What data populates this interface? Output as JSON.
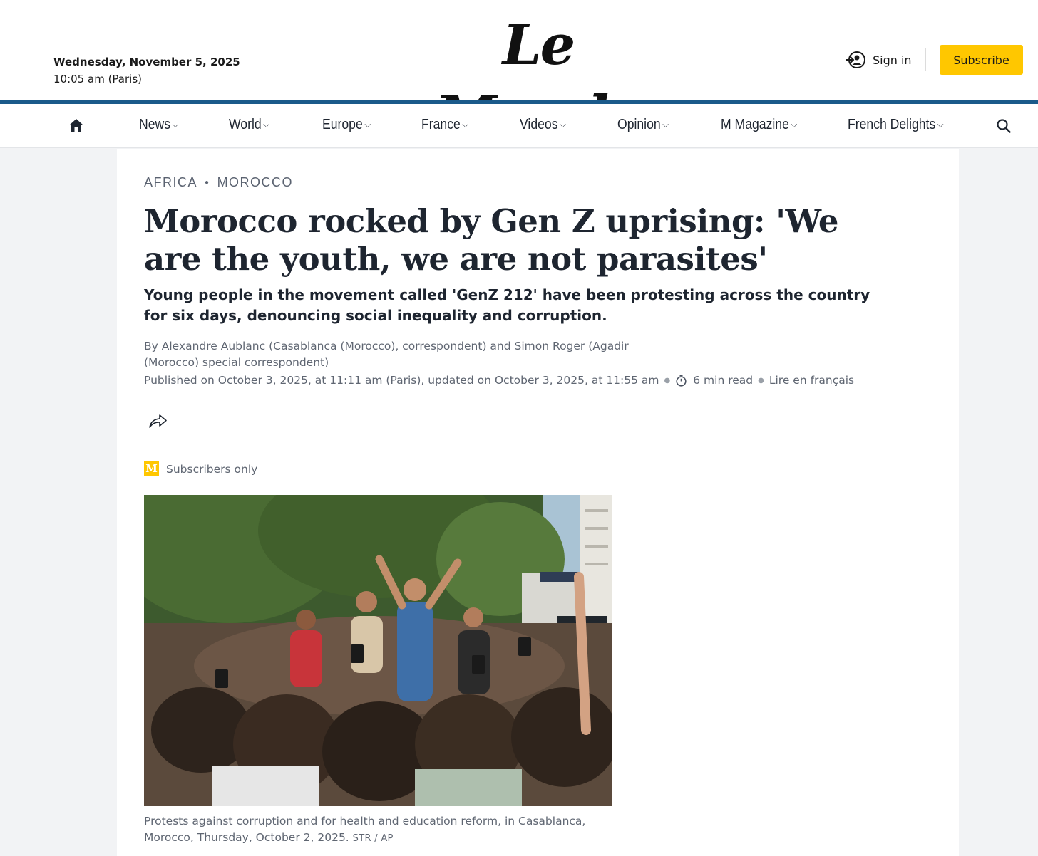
{
  "header": {
    "date": "Wednesday, November 5, 2025",
    "time": "10:05 am (Paris)",
    "logo_text": "Le Monde",
    "signin_label": "Sign in",
    "subscribe_label": "Subscribe",
    "accent_color": "#ffc700",
    "rule_color": "#1a5a8a"
  },
  "nav": {
    "items": [
      {
        "label": "News"
      },
      {
        "label": "World"
      },
      {
        "label": "Europe"
      },
      {
        "label": "France"
      },
      {
        "label": "Videos"
      },
      {
        "label": "Opinion"
      },
      {
        "label": "M Magazine"
      },
      {
        "label": "French Delights"
      }
    ],
    "home_icon": "home-icon",
    "search_icon": "search-icon"
  },
  "article": {
    "section": "AFRICA",
    "subsection": "MOROCCO",
    "headline": "Morocco rocked by Gen Z uprising: 'We are the youth, we are not parasites'",
    "standfirst": "Young people in the movement called 'GenZ 212' have been protesting across the country for six days, denouncing social inequality and corruption.",
    "byline": "By Alexandre Aublanc (Casablanca (Morocco), correspondent) and Simon Roger (Agadir (Morocco) special correspondent)",
    "published": "Published on October 3, 2025, at 11:11 am (Paris), updated on October 3, 2025, at 11:55 am",
    "read_time": "6 min read",
    "french_link": "Lire en français",
    "subscribers_badge": "M",
    "subscribers_label": "Subscribers only",
    "caption": "Protests against corruption and for health and education reform, in Casablanca, Morocco, Thursday, October 2, 2025.",
    "credit": "STR / AP"
  }
}
